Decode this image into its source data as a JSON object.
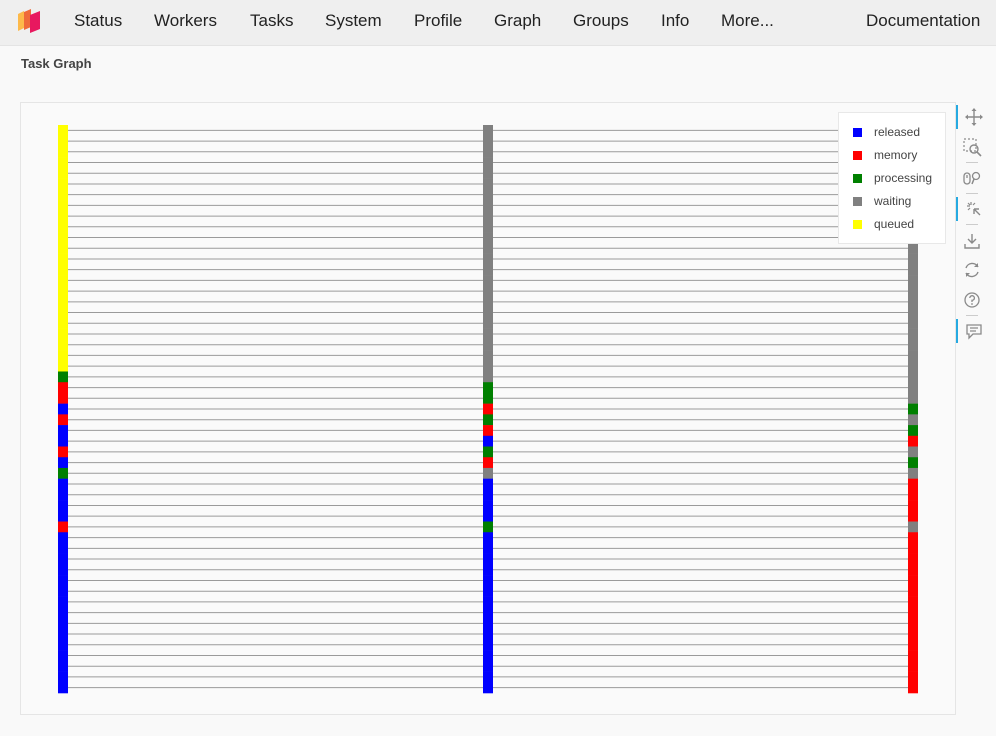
{
  "navbar": {
    "items": [
      {
        "label": "Status"
      },
      {
        "label": "Workers"
      },
      {
        "label": "Tasks"
      },
      {
        "label": "System"
      },
      {
        "label": "Profile"
      },
      {
        "label": "Graph"
      },
      {
        "label": "Groups"
      },
      {
        "label": "Info"
      },
      {
        "label": "More..."
      }
    ],
    "documentation_label": "Documentation"
  },
  "page": {
    "title": "Task Graph"
  },
  "legend": [
    {
      "label": "released",
      "color": "#0000ff"
    },
    {
      "label": "memory",
      "color": "#ff0000"
    },
    {
      "label": "processing",
      "color": "#008000"
    },
    {
      "label": "waiting",
      "color": "#808080"
    },
    {
      "label": "queued",
      "color": "#ffff00"
    }
  ],
  "graph": {
    "columns": [
      {
        "states": [
          "queued",
          "queued",
          "queued",
          "queued",
          "queued",
          "queued",
          "queued",
          "queued",
          "queued",
          "queued",
          "queued",
          "queued",
          "queued",
          "queued",
          "queued",
          "queued",
          "queued",
          "queued",
          "queued",
          "queued",
          "queued",
          "queued",
          "queued",
          "processing",
          "memory",
          "memory",
          "released",
          "memory",
          "released",
          "released",
          "memory",
          "released",
          "processing",
          "released",
          "released",
          "released",
          "released",
          "memory",
          "released",
          "released",
          "released",
          "released",
          "released",
          "released",
          "released",
          "released",
          "released",
          "released",
          "released",
          "released",
          "released",
          "released",
          "released"
        ]
      },
      {
        "states": [
          "waiting",
          "waiting",
          "waiting",
          "waiting",
          "waiting",
          "waiting",
          "waiting",
          "waiting",
          "waiting",
          "waiting",
          "waiting",
          "waiting",
          "waiting",
          "waiting",
          "waiting",
          "waiting",
          "waiting",
          "waiting",
          "waiting",
          "waiting",
          "waiting",
          "waiting",
          "waiting",
          "waiting",
          "processing",
          "processing",
          "memory",
          "processing",
          "memory",
          "released",
          "processing",
          "memory",
          "waiting",
          "released",
          "released",
          "released",
          "released",
          "processing",
          "released",
          "released",
          "released",
          "released",
          "released",
          "released",
          "released",
          "released",
          "released",
          "released",
          "released",
          "released",
          "released",
          "released",
          "released"
        ]
      },
      {
        "states": [
          "waiting",
          "waiting",
          "waiting",
          "waiting",
          "waiting",
          "waiting",
          "waiting",
          "waiting",
          "waiting",
          "waiting",
          "waiting",
          "waiting",
          "waiting",
          "waiting",
          "waiting",
          "waiting",
          "waiting",
          "waiting",
          "waiting",
          "waiting",
          "waiting",
          "waiting",
          "waiting",
          "waiting",
          "waiting",
          "waiting",
          "processing",
          "waiting",
          "processing",
          "memory",
          "waiting",
          "processing",
          "waiting",
          "memory",
          "memory",
          "memory",
          "memory",
          "waiting",
          "memory",
          "memory",
          "memory",
          "memory",
          "memory",
          "memory",
          "memory",
          "memory",
          "memory",
          "memory",
          "memory",
          "memory",
          "memory",
          "memory",
          "memory"
        ]
      }
    ],
    "edge_color": "#9a9a9a"
  },
  "toolbar": [
    {
      "icon": "pan-icon"
    },
    {
      "icon": "box-zoom-icon"
    },
    {
      "icon": "wheel-zoom-icon"
    },
    {
      "icon": "tap-icon"
    },
    {
      "icon": "save-icon"
    },
    {
      "icon": "reset-icon"
    },
    {
      "icon": "help-icon"
    },
    {
      "icon": "hover-icon"
    }
  ]
}
